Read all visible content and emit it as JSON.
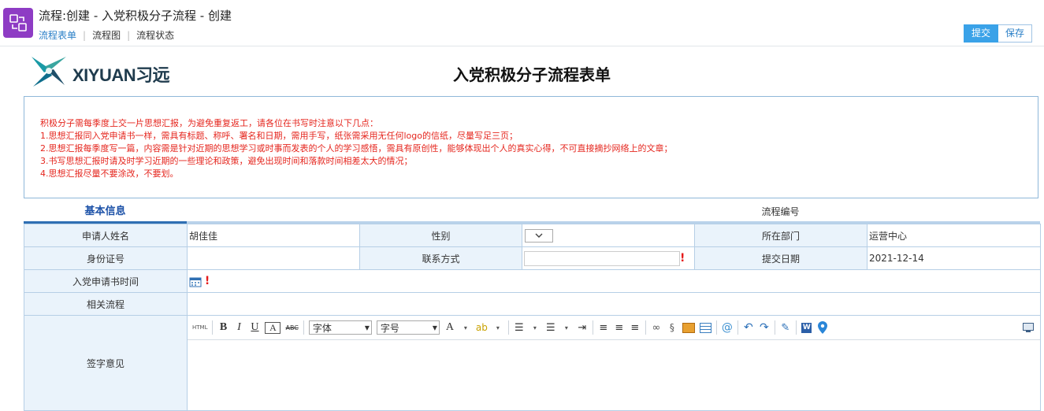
{
  "window": {
    "title": "流程:创建 - 入党积极分子流程 - 创建"
  },
  "nav": {
    "tabs": [
      {
        "label": "流程表单"
      },
      {
        "label": "流程图"
      },
      {
        "label": "流程状态"
      }
    ]
  },
  "actions": {
    "submit": "提交",
    "save": "保存"
  },
  "form": {
    "logo_text": "XIYUAN习远",
    "title": "入党积极分子流程表单",
    "notice": [
      "积极分子需每季度上交一片思想汇报，为避免重复返工，请各位在书写时注意以下几点：",
      "1.思想汇报同入党申请书一样，需具有标题、称呼、署名和日期，需用手写，纸张需采用无任何logo的信纸，尽量写足三页；",
      "2.思想汇报每季度写一篇，内容需是针对近期的思想学习或时事而发表的个人的学习感悟，需具有原创性，能够体现出个人的真实心得，不可直接摘抄网络上的文章；",
      "3.书写思想汇报时请及时学习近期的一些理论和政策，避免出现时间和落款时间相差太大的情况；",
      "4.思想汇报尽量不要涂改，不要划。"
    ],
    "section": "基本信息",
    "flow_no_label": "流程编号",
    "fields": {
      "applicant_label": "申请人姓名",
      "applicant_value": "胡佳佳",
      "gender_label": "性别",
      "dept_label": "所在部门",
      "dept_value": "运营中心",
      "id_label": "身份证号",
      "contact_label": "联系方式",
      "submit_date_label": "提交日期",
      "submit_date_value": "2021-12-14",
      "apply_time_label": "入党申请书时间",
      "related_label": "相关流程",
      "sign_label": "签字意见"
    },
    "required_mark": "!",
    "editor": {
      "html": "HTML",
      "bold": "B",
      "italic": "I",
      "underline": "U",
      "boxed": "A",
      "strike": "ABC",
      "font_family": "字体",
      "font_size": "字号",
      "font_color": "A"
    }
  },
  "colors": {
    "accent": "#3aa2e8",
    "notice_text": "#e5261e",
    "section_blue": "#1d52a8",
    "label_bg": "#eaf3fb"
  }
}
